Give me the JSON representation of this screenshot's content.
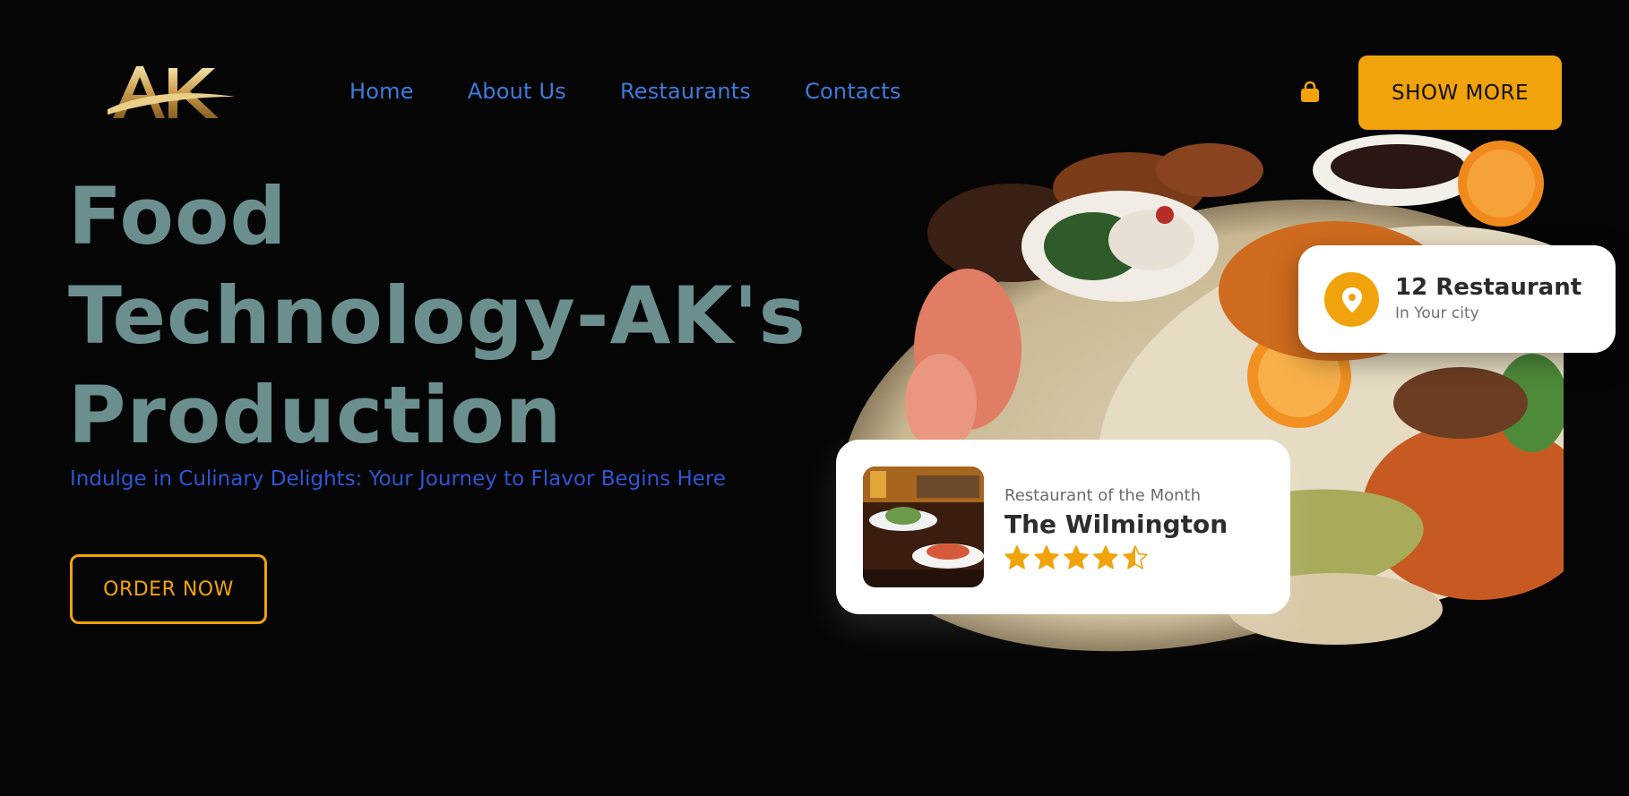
{
  "header": {
    "logo_text": "AK",
    "nav": [
      {
        "label": "Home"
      },
      {
        "label": "About Us"
      },
      {
        "label": "Restaurants"
      },
      {
        "label": "Contacts"
      }
    ],
    "cart_icon": "shopping-bag-icon",
    "show_more_label": "SHOW MORE"
  },
  "hero": {
    "title_lines": [
      "Food",
      "Technology-AK's",
      "Production"
    ],
    "subtitle": "Indulge in Culinary Delights: Your Journey to Flavor Begins Here",
    "order_button_label": "ORDER NOW"
  },
  "restaurant_count_card": {
    "icon": "location-pin-icon",
    "title": "12 Restaurant",
    "subtitle": "In Your city"
  },
  "restaurant_month_card": {
    "label": "Restaurant of the Month",
    "name": "The Wilmington",
    "rating": 4.5,
    "rating_max": 5
  },
  "colors": {
    "background": "#050505",
    "accent": "#f0a30a",
    "nav_link": "#3d7bdc",
    "title": "#6a8f8e",
    "subtitle": "#2f55d4"
  }
}
